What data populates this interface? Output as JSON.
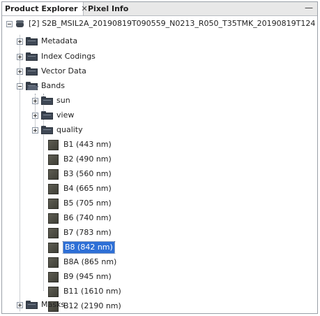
{
  "tabs": [
    {
      "label": "Product Explorer",
      "close": "✕"
    },
    {
      "label": "Pixel Info"
    }
  ],
  "minimize": "—",
  "tree": {
    "product": "[2] S2B_MSIL2A_20190819T090559_N0213_R050_T35TMK_20190819T124",
    "top_items": [
      {
        "label": "Metadata"
      },
      {
        "label": "Index Codings"
      },
      {
        "label": "Vector Data"
      },
      {
        "label": "Bands"
      }
    ],
    "band_folders": [
      {
        "label": "sun"
      },
      {
        "label": "view"
      },
      {
        "label": "quality"
      }
    ],
    "bands": [
      {
        "label": "B1 (443 nm)"
      },
      {
        "label": "B2 (490 nm)"
      },
      {
        "label": "B3 (560 nm)"
      },
      {
        "label": "B4 (665 nm)"
      },
      {
        "label": "B5 (705 nm)"
      },
      {
        "label": "B6 (740 nm)"
      },
      {
        "label": "B7 (783 nm)"
      },
      {
        "label": "B8 (842 nm)",
        "selected": true
      },
      {
        "label": "B8A (865 nm)"
      },
      {
        "label": "B9 (945 nm)"
      },
      {
        "label": "B11 (1610 nm)"
      },
      {
        "label": "B12 (2190 nm)"
      }
    ],
    "masks": {
      "label": "Masks"
    }
  }
}
